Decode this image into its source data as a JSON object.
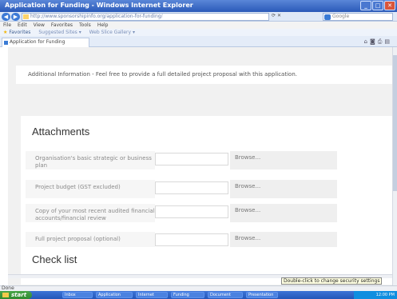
{
  "window": {
    "title": "Application for Funding - Windows Internet Explorer",
    "minimize_label": "_",
    "maximize_label": "□",
    "close_label": "✕"
  },
  "address_bar": {
    "url": "http://www.sponsorshipinfo.org/application-for-funding/",
    "search_placeholder": "Google"
  },
  "menu": {
    "items": [
      "File",
      "Edit",
      "View",
      "Favorites",
      "Tools",
      "Help"
    ]
  },
  "favorites_bar": {
    "label": "Favorites",
    "items": [
      "Suggested Sites ▾",
      "Web Slice Gallery ▾"
    ]
  },
  "tab": {
    "label": "Application for Funding"
  },
  "page": {
    "additional_info": "Additional Information - Feel free to provide a full detailed project proposal with this application.",
    "attachments": {
      "heading": "Attachments",
      "rows": [
        {
          "label": "Organisation's basic strategic or business plan",
          "button": "Browse..."
        },
        {
          "label": "Project budget (GST excluded)",
          "button": "Browse..."
        },
        {
          "label": "Copy of your most recent audited financial accounts/financial review",
          "button": "Browse..."
        },
        {
          "label": "Full project proposal (optional)",
          "button": "Browse..."
        }
      ]
    },
    "checklist": {
      "heading": "Check list"
    }
  },
  "status_bar": {
    "text": "Done",
    "tooltip": "Double-click to change security settings"
  },
  "taskbar": {
    "start_label": "start",
    "buttons": [
      "Inbox",
      "Application",
      "Internet",
      "Funding",
      "Document",
      "Presentation"
    ],
    "tray_text": "12:00 PM"
  },
  "colors": {
    "titlebar": "#2a59b8",
    "accent_orange": "#f5b335",
    "taskbar": "#2356b8",
    "start_green": "#2f8a2f"
  }
}
